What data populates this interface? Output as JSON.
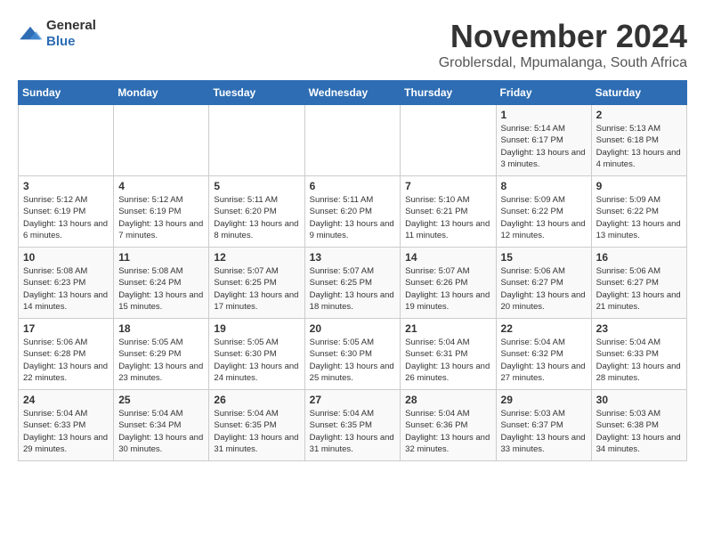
{
  "header": {
    "logo_general": "General",
    "logo_blue": "Blue",
    "title": "November 2024",
    "subtitle": "Groblersdal, Mpumalanga, South Africa"
  },
  "days_of_week": [
    "Sunday",
    "Monday",
    "Tuesday",
    "Wednesday",
    "Thursday",
    "Friday",
    "Saturday"
  ],
  "weeks": [
    [
      {
        "day": "",
        "info": ""
      },
      {
        "day": "",
        "info": ""
      },
      {
        "day": "",
        "info": ""
      },
      {
        "day": "",
        "info": ""
      },
      {
        "day": "",
        "info": ""
      },
      {
        "day": "1",
        "info": "Sunrise: 5:14 AM\nSunset: 6:17 PM\nDaylight: 13 hours and 3 minutes."
      },
      {
        "day": "2",
        "info": "Sunrise: 5:13 AM\nSunset: 6:18 PM\nDaylight: 13 hours and 4 minutes."
      }
    ],
    [
      {
        "day": "3",
        "info": "Sunrise: 5:12 AM\nSunset: 6:19 PM\nDaylight: 13 hours and 6 minutes."
      },
      {
        "day": "4",
        "info": "Sunrise: 5:12 AM\nSunset: 6:19 PM\nDaylight: 13 hours and 7 minutes."
      },
      {
        "day": "5",
        "info": "Sunrise: 5:11 AM\nSunset: 6:20 PM\nDaylight: 13 hours and 8 minutes."
      },
      {
        "day": "6",
        "info": "Sunrise: 5:11 AM\nSunset: 6:20 PM\nDaylight: 13 hours and 9 minutes."
      },
      {
        "day": "7",
        "info": "Sunrise: 5:10 AM\nSunset: 6:21 PM\nDaylight: 13 hours and 11 minutes."
      },
      {
        "day": "8",
        "info": "Sunrise: 5:09 AM\nSunset: 6:22 PM\nDaylight: 13 hours and 12 minutes."
      },
      {
        "day": "9",
        "info": "Sunrise: 5:09 AM\nSunset: 6:22 PM\nDaylight: 13 hours and 13 minutes."
      }
    ],
    [
      {
        "day": "10",
        "info": "Sunrise: 5:08 AM\nSunset: 6:23 PM\nDaylight: 13 hours and 14 minutes."
      },
      {
        "day": "11",
        "info": "Sunrise: 5:08 AM\nSunset: 6:24 PM\nDaylight: 13 hours and 15 minutes."
      },
      {
        "day": "12",
        "info": "Sunrise: 5:07 AM\nSunset: 6:25 PM\nDaylight: 13 hours and 17 minutes."
      },
      {
        "day": "13",
        "info": "Sunrise: 5:07 AM\nSunset: 6:25 PM\nDaylight: 13 hours and 18 minutes."
      },
      {
        "day": "14",
        "info": "Sunrise: 5:07 AM\nSunset: 6:26 PM\nDaylight: 13 hours and 19 minutes."
      },
      {
        "day": "15",
        "info": "Sunrise: 5:06 AM\nSunset: 6:27 PM\nDaylight: 13 hours and 20 minutes."
      },
      {
        "day": "16",
        "info": "Sunrise: 5:06 AM\nSunset: 6:27 PM\nDaylight: 13 hours and 21 minutes."
      }
    ],
    [
      {
        "day": "17",
        "info": "Sunrise: 5:06 AM\nSunset: 6:28 PM\nDaylight: 13 hours and 22 minutes."
      },
      {
        "day": "18",
        "info": "Sunrise: 5:05 AM\nSunset: 6:29 PM\nDaylight: 13 hours and 23 minutes."
      },
      {
        "day": "19",
        "info": "Sunrise: 5:05 AM\nSunset: 6:30 PM\nDaylight: 13 hours and 24 minutes."
      },
      {
        "day": "20",
        "info": "Sunrise: 5:05 AM\nSunset: 6:30 PM\nDaylight: 13 hours and 25 minutes."
      },
      {
        "day": "21",
        "info": "Sunrise: 5:04 AM\nSunset: 6:31 PM\nDaylight: 13 hours and 26 minutes."
      },
      {
        "day": "22",
        "info": "Sunrise: 5:04 AM\nSunset: 6:32 PM\nDaylight: 13 hours and 27 minutes."
      },
      {
        "day": "23",
        "info": "Sunrise: 5:04 AM\nSunset: 6:33 PM\nDaylight: 13 hours and 28 minutes."
      }
    ],
    [
      {
        "day": "24",
        "info": "Sunrise: 5:04 AM\nSunset: 6:33 PM\nDaylight: 13 hours and 29 minutes."
      },
      {
        "day": "25",
        "info": "Sunrise: 5:04 AM\nSunset: 6:34 PM\nDaylight: 13 hours and 30 minutes."
      },
      {
        "day": "26",
        "info": "Sunrise: 5:04 AM\nSunset: 6:35 PM\nDaylight: 13 hours and 31 minutes."
      },
      {
        "day": "27",
        "info": "Sunrise: 5:04 AM\nSunset: 6:35 PM\nDaylight: 13 hours and 31 minutes."
      },
      {
        "day": "28",
        "info": "Sunrise: 5:04 AM\nSunset: 6:36 PM\nDaylight: 13 hours and 32 minutes."
      },
      {
        "day": "29",
        "info": "Sunrise: 5:03 AM\nSunset: 6:37 PM\nDaylight: 13 hours and 33 minutes."
      },
      {
        "day": "30",
        "info": "Sunrise: 5:03 AM\nSunset: 6:38 PM\nDaylight: 13 hours and 34 minutes."
      }
    ]
  ]
}
